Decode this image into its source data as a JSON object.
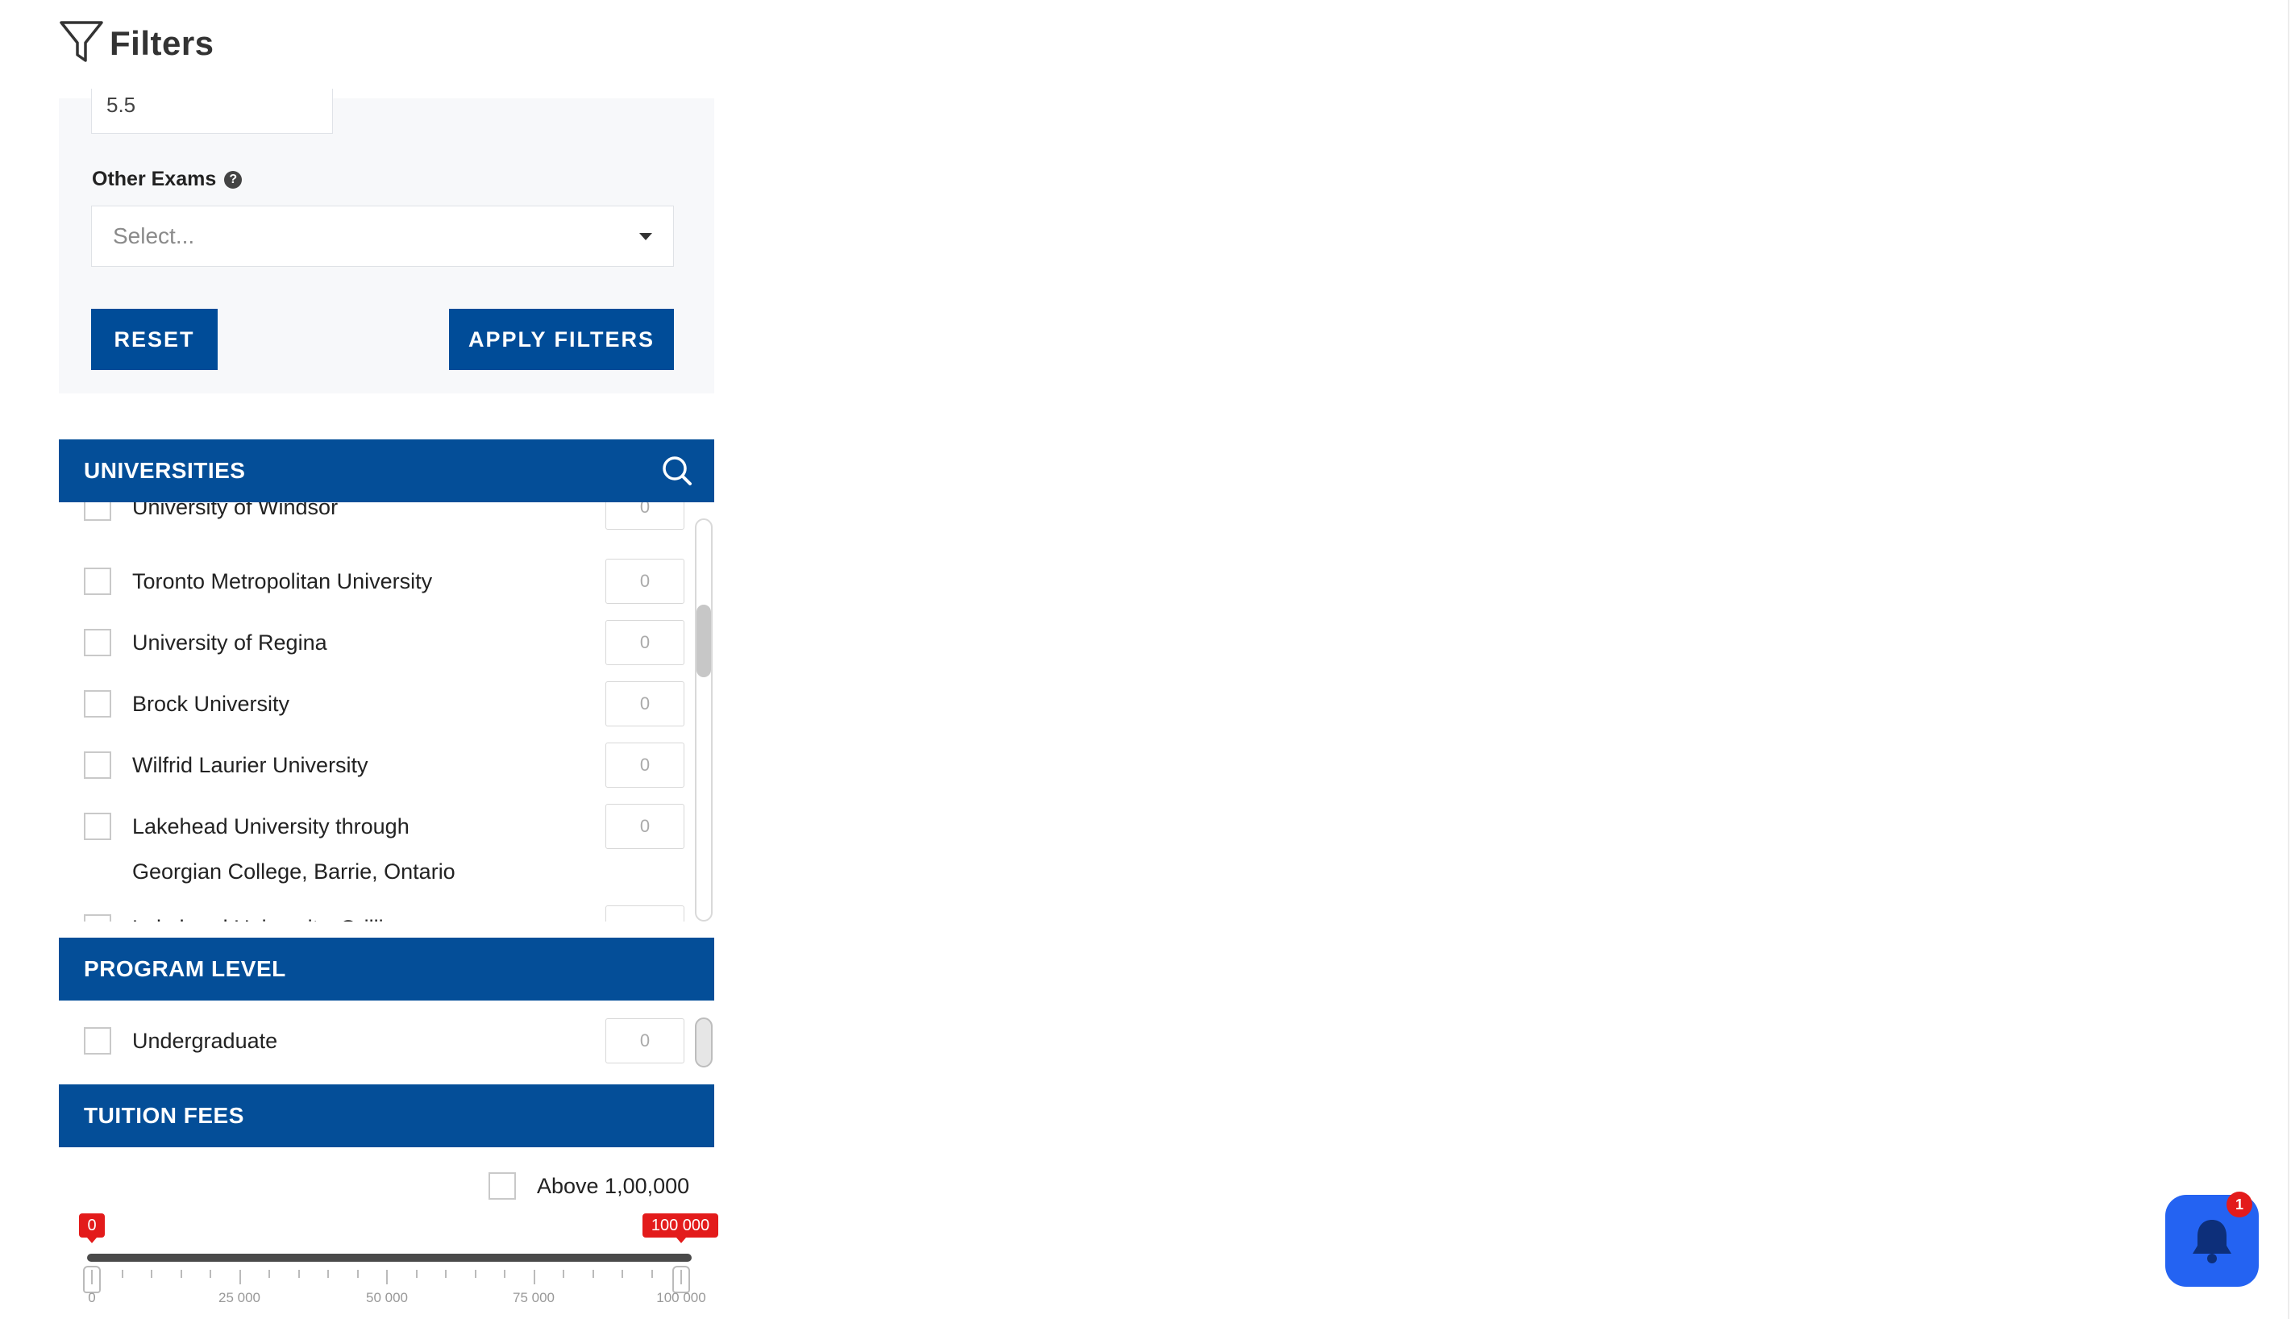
{
  "header": {
    "title": "Filters",
    "icon": "funnel-icon"
  },
  "filters": {
    "band_score_value": "5.5",
    "other_exams_label": "Other Exams",
    "other_exams_help_icon": "question-circle-icon",
    "other_exams_placeholder": "Select...",
    "reset_label": "RESET",
    "apply_label": "APPLY FILTERS"
  },
  "universities": {
    "title": "UNIVERSITIES",
    "search_icon": "search-icon",
    "items": [
      {
        "label": "University of Windsor",
        "count": "0"
      },
      {
        "label": "Toronto Metropolitan University",
        "count": "0"
      },
      {
        "label": "University of Regina",
        "count": "0"
      },
      {
        "label": "Brock University",
        "count": "0"
      },
      {
        "label": "Wilfrid Laurier University",
        "count": "0"
      },
      {
        "label": "Lakehead University through Georgian College, Barrie, Ontario",
        "count": "0"
      },
      {
        "label": "Lakehead University, Orillia",
        "count": ""
      }
    ]
  },
  "program_level": {
    "title": "PROGRAM LEVEL",
    "items": [
      {
        "label": "Undergraduate",
        "count": "0"
      }
    ]
  },
  "tuition_fees": {
    "title": "TUITION FEES",
    "above_label": "Above 1,00,000",
    "range_min": "0",
    "range_max": "100 000",
    "tick_labels": [
      "0",
      "25 000",
      "50 000",
      "75 000",
      "100 000"
    ]
  },
  "notification": {
    "icon": "bell-icon",
    "badge_count": "1"
  },
  "colors": {
    "primary": "#044e98",
    "accent": "#e31b1b",
    "fab": "#2463f2"
  }
}
